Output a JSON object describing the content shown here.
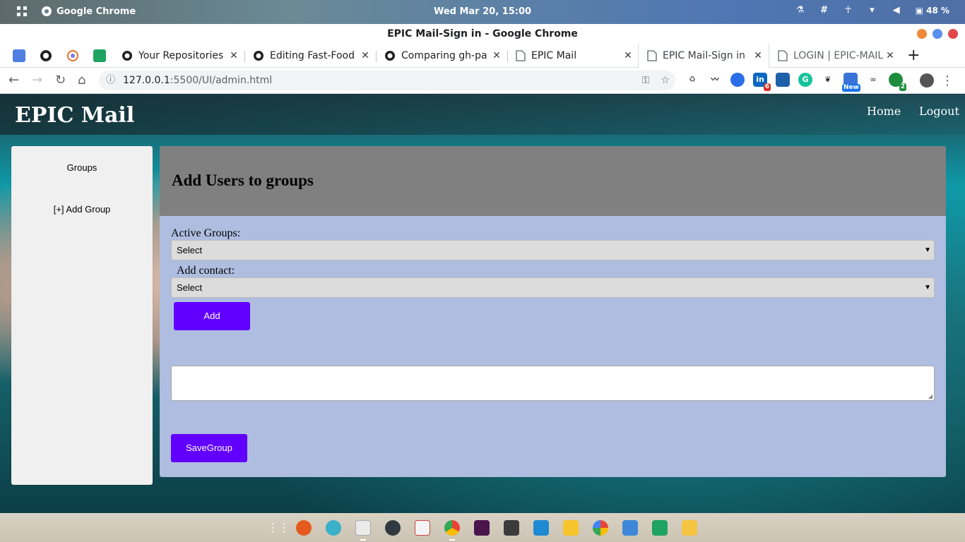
{
  "os": {
    "app_name": "Google Chrome",
    "clock": "Wed Mar 20, 15:00",
    "battery": "48 %"
  },
  "window": {
    "title": "EPIC Mail-Sign in - Google Chrome"
  },
  "tabs": [
    {
      "label": "Your Repositories",
      "icon": "github-icon"
    },
    {
      "label": "Editing Fast-Food",
      "icon": "github-icon"
    },
    {
      "label": "Comparing gh-pa",
      "icon": "github-icon"
    },
    {
      "label": "EPIC Mail",
      "icon": "page-icon"
    },
    {
      "label": "EPIC Mail-Sign in",
      "icon": "page-icon",
      "active": true
    },
    {
      "label": "LOGIN | EPIC-MAIL",
      "icon": "page-icon"
    }
  ],
  "address": {
    "host": "127.0.0.1",
    "path": ":5500/UI/admin.html"
  },
  "extensions": {
    "linkedin_badge": "6",
    "new_badge": "New",
    "green_badge": "2"
  },
  "page": {
    "brand": "EPIC Mail",
    "nav": {
      "home": "Home",
      "logout": "Logout"
    },
    "sidebar": {
      "groups": "Groups",
      "add_group": "[+] Add Group"
    },
    "main": {
      "heading": "Add Users to groups",
      "active_groups_label": "Active Groups:",
      "active_groups_value": "Select",
      "add_contact_label": "Add contact:",
      "add_contact_value": "Select",
      "add_button": "Add",
      "save_button": "SaveGroup"
    }
  },
  "colors": {
    "accent_button": "#6200ff",
    "main_panel": "#aebde0",
    "main_header": "#808080",
    "sidebar": "#f0f0f0"
  }
}
